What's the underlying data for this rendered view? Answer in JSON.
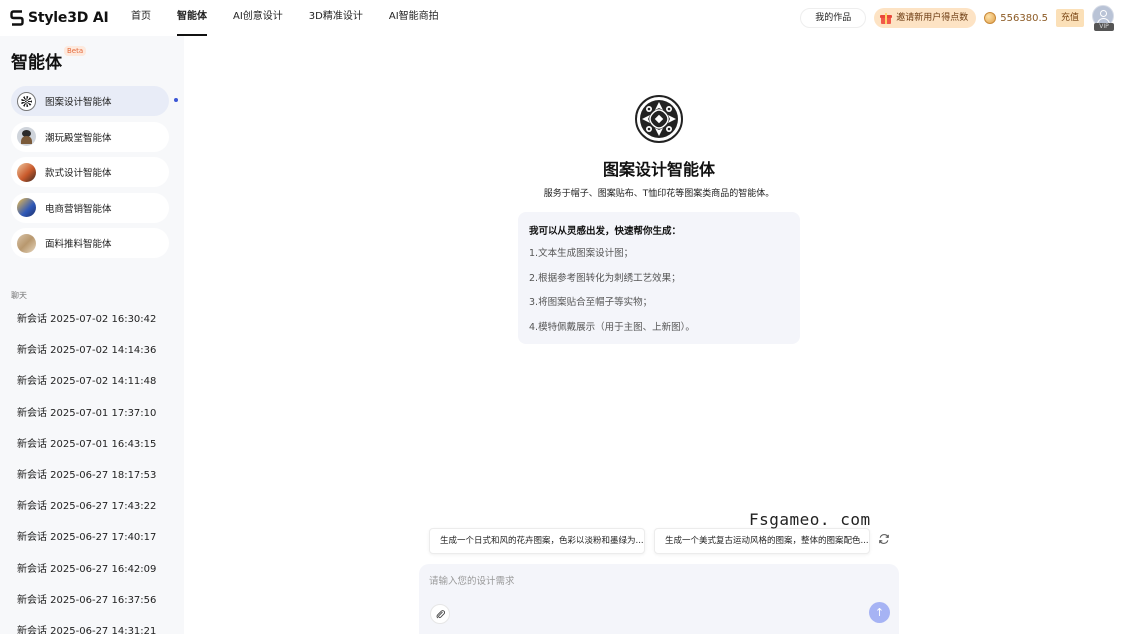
{
  "app": {
    "brand": "Style3D AI"
  },
  "nav": [
    "首页",
    "智能体",
    "AI创意设计",
    "3D精准设计",
    "AI智能商拍"
  ],
  "header": {
    "my_works": "我的作品",
    "invite": "邀请新用户得点数",
    "points": "556380.5",
    "recharge": "充值",
    "vip": "VIP"
  },
  "sidebar": {
    "title": "智能体",
    "beta": "Beta",
    "agents": [
      {
        "label": "图案设计智能体",
        "icon": "pattern-icon",
        "active": true
      },
      {
        "label": "潮玩殿堂智能体",
        "icon": "toy-icon",
        "active": false
      },
      {
        "label": "款式设计智能体",
        "icon": "style-icon",
        "active": false
      },
      {
        "label": "电商营销智能体",
        "icon": "ecommerce-icon",
        "active": false
      },
      {
        "label": "面料推料智能体",
        "icon": "fabric-icon",
        "active": false
      }
    ],
    "chat_heading": "聊天",
    "history": [
      "新会话 2025-07-02 16:30:42",
      "新会话 2025-07-02 14:14:36",
      "新会话 2025-07-02 14:11:48",
      "新会话 2025-07-01 17:37:10",
      "新会话 2025-07-01 16:43:15",
      "新会话 2025-06-27 18:17:53",
      "新会话 2025-06-27 17:43:22",
      "新会话 2025-06-27 17:40:17",
      "新会话 2025-06-27 16:42:09",
      "新会话 2025-06-27 16:37:56",
      "新会话 2025-06-27 14:31:21"
    ]
  },
  "main": {
    "agent_title": "图案设计智能体",
    "agent_desc": "服务于帽子、图案贴布、T恤印花等图案类商品的智能体。",
    "capabilities_heading": "我可以从灵感出发，快速帮你生成：",
    "capabilities": [
      "1.文本生成图案设计图；",
      "2.根据参考图转化为刺绣工艺效果；",
      "3.将图案贴合至帽子等实物；",
      "4.模特佩戴展示（用于主图、上新图）。"
    ],
    "suggestions": [
      "生成一个日式和风的花卉图案，色彩以淡粉和墨绿为...",
      "生成一个美式复古运动风格的图案，整体的图案配色..."
    ],
    "input_placeholder": "请输入您的设计需求"
  },
  "watermark": "Fsgameo. com",
  "colors": {
    "accent": "#3d57d6",
    "send": "#a6b3f4",
    "invite_bg": "#fde3c4"
  }
}
